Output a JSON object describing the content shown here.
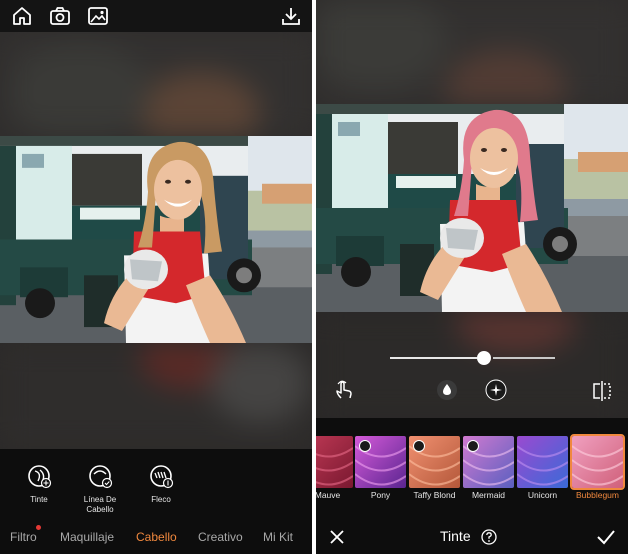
{
  "left": {
    "topbar_icons": [
      "home-icon",
      "camera-icon",
      "gallery-icon",
      "download-icon"
    ],
    "tools": [
      {
        "label": "Tinte",
        "icon": "hair-dye-icon"
      },
      {
        "label": "Línea De Cabello",
        "icon": "hairline-icon"
      },
      {
        "label": "Fleco",
        "icon": "bangs-icon"
      }
    ],
    "nav": [
      "Filtro",
      "Maquillaje",
      "Cabello",
      "Creativo",
      "Mi Kit"
    ],
    "nav_active": "Cabello",
    "nav_dot": "Filtro"
  },
  "right": {
    "slider_value": 0.5,
    "control_icons": [
      "touch-icon",
      "drop-icon",
      "sparkle-icon",
      "compare-icon"
    ],
    "swatches": [
      {
        "label": "Mauve",
        "colors": [
          "#c03a56",
          "#7a1830"
        ],
        "checked": false,
        "selected": false
      },
      {
        "label": "Pony",
        "colors": [
          "#d45ad8",
          "#5a2590"
        ],
        "checked": true,
        "selected": false
      },
      {
        "label": "Taffy Blond",
        "colors": [
          "#f09070",
          "#b4583a"
        ],
        "checked": true,
        "selected": false
      },
      {
        "label": "Mermaid",
        "colors": [
          "#d07ad0",
          "#5a5fc0"
        ],
        "checked": true,
        "selected": false
      },
      {
        "label": "Unicorn",
        "colors": [
          "#9a4ad0",
          "#3a6ad8"
        ],
        "checked": false,
        "selected": false
      },
      {
        "label": "Bubblegum",
        "colors": [
          "#f0a0c0",
          "#d0607a"
        ],
        "checked": false,
        "selected": true
      }
    ],
    "bottom_title": "Tinte",
    "bottom_icons": [
      "close-icon",
      "help-icon",
      "check-icon"
    ]
  },
  "colors": {
    "accent": "#f0883e",
    "bar": "#0d0d0d",
    "topbar": "#141414"
  }
}
